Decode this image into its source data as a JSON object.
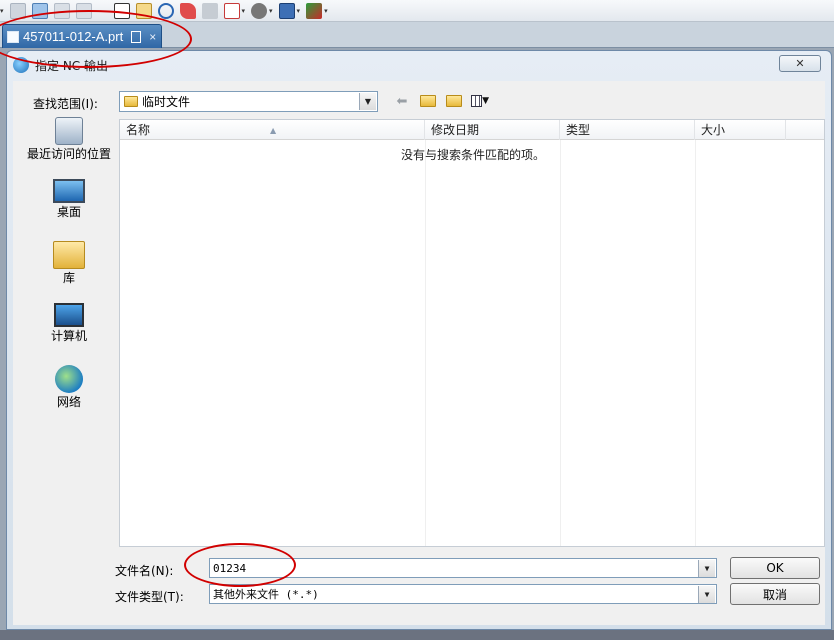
{
  "tab": {
    "title": "457011-012-A.prt",
    "close": "×"
  },
  "dialog": {
    "title": "指定 NC 输出",
    "close_label": "✕",
    "look_in_label": "查找范围(I):",
    "look_in_value": "临时文件",
    "places": [
      {
        "label": "最近访问的位置",
        "icon": "recent-places-icon"
      },
      {
        "label": "桌面",
        "icon": "desktop-icon"
      },
      {
        "label": "库",
        "icon": "libraries-icon"
      },
      {
        "label": "计算机",
        "icon": "computer-icon"
      },
      {
        "label": "网络",
        "icon": "network-icon"
      }
    ],
    "columns": [
      "名称",
      "修改日期",
      "类型",
      "大小"
    ],
    "empty_message": "没有与搜索条件匹配的项。",
    "filename_label": "文件名(N):",
    "filename_value": "01234",
    "filetype_label": "文件类型(T):",
    "filetype_value": "其他外来文件 (*.*)",
    "ok_label": "OK",
    "cancel_label": "取消"
  },
  "colors": {
    "annotation": "#d10000",
    "tab_bg": "#2f67a6"
  }
}
